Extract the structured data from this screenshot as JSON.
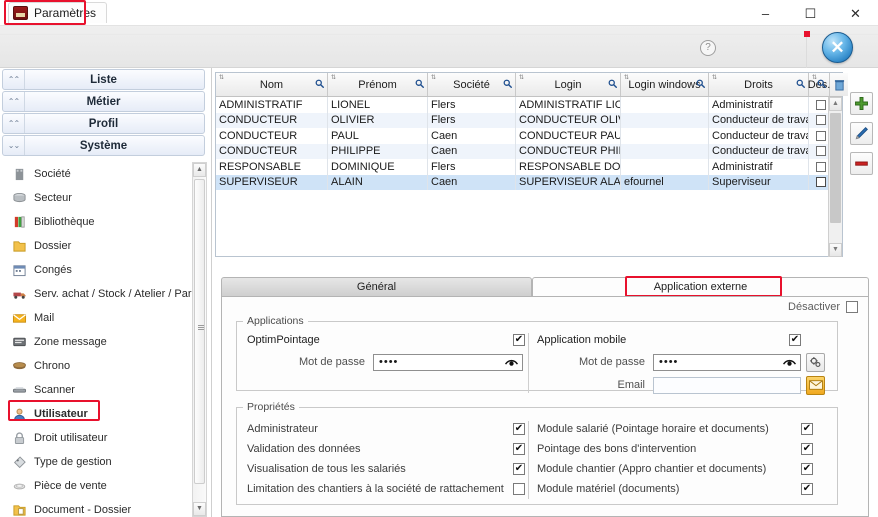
{
  "window": {
    "tab_label": "Paramètres",
    "app_icon": "etp-logo-icon",
    "minimize": "–",
    "maximize": "☐",
    "close": "✕"
  },
  "ribbon": {
    "help_icon": "?",
    "close_round_icon": "✕"
  },
  "sidebar": {
    "accordions": [
      {
        "label": "Liste",
        "icon": "chevron-up-icon",
        "chev": "«",
        "expanded": false
      },
      {
        "label": "Métier",
        "icon": "chevron-up-icon",
        "chev": "«",
        "expanded": false
      },
      {
        "label": "Profil",
        "icon": "chevron-up-icon",
        "chev": "«",
        "expanded": false
      },
      {
        "label": "Système",
        "icon": "chevron-down-icon",
        "chev": "»",
        "expanded": true
      }
    ],
    "items": [
      {
        "label": "Société",
        "icon": "building-icon",
        "active": false
      },
      {
        "label": "Secteur",
        "icon": "cylinder-icon",
        "active": false
      },
      {
        "label": "Bibliothèque",
        "icon": "books-icon",
        "active": false
      },
      {
        "label": "Dossier",
        "icon": "folder-icon",
        "active": false
      },
      {
        "label": "Congés",
        "icon": "calendar-icon",
        "active": false
      },
      {
        "label": "Serv. achat / Stock / Atelier / Parc",
        "icon": "truck-icon",
        "active": false
      },
      {
        "label": "Mail",
        "icon": "envelope-icon",
        "active": false
      },
      {
        "label": "Zone message",
        "icon": "message-icon",
        "active": false
      },
      {
        "label": "Chrono",
        "icon": "chrono-icon",
        "active": false
      },
      {
        "label": "Scanner",
        "icon": "scanner-icon",
        "active": false
      },
      {
        "label": "Utilisateur",
        "icon": "user-icon",
        "active": true
      },
      {
        "label": "Droit utilisateur",
        "icon": "lock-icon",
        "active": false
      },
      {
        "label": "Type de gestion",
        "icon": "tag-icon",
        "active": false
      },
      {
        "label": "Pièce de vente",
        "icon": "coin-icon",
        "active": false
      },
      {
        "label": "Document - Dossier",
        "icon": "folder-doc-icon",
        "active": false
      }
    ]
  },
  "grid": {
    "columns": [
      {
        "label": "Nom",
        "width": 112
      },
      {
        "label": "Prénom",
        "width": 100
      },
      {
        "label": "Société",
        "width": 88
      },
      {
        "label": "Login",
        "width": 105
      },
      {
        "label": "Login windows",
        "width": 88
      },
      {
        "label": "Droits",
        "width": 100
      },
      {
        "label": "Des.",
        "width": 21
      }
    ],
    "search_icon": "magnifier-icon",
    "delete_column_icon": "trash-icon",
    "rows": [
      {
        "nom": "ADMINISTRATIF",
        "prenom": "LIONEL",
        "societe": "Flers",
        "login": "ADMINISTRATIF LIONEL",
        "login_windows": "",
        "droits": "Administratif",
        "des": false,
        "selected": false
      },
      {
        "nom": "CONDUCTEUR",
        "prenom": "OLIVIER",
        "societe": "Flers",
        "login": "CONDUCTEUR OLIVIER",
        "login_windows": "",
        "droits": "Conducteur de travaux",
        "des": false,
        "selected": false
      },
      {
        "nom": "CONDUCTEUR",
        "prenom": "PAUL",
        "societe": "Caen",
        "login": "CONDUCTEUR PAUL",
        "login_windows": "",
        "droits": "Conducteur de travaux",
        "des": false,
        "selected": false
      },
      {
        "nom": "CONDUCTEUR",
        "prenom": "PHILIPPE",
        "societe": "Caen",
        "login": "CONDUCTEUR PHILIPPE",
        "login_windows": "",
        "droits": "Conducteur de travaux",
        "des": false,
        "selected": false
      },
      {
        "nom": "RESPONSABLE",
        "prenom": "DOMINIQUE",
        "societe": "Flers",
        "login": "RESPONSABLE DOMIN...",
        "login_windows": "",
        "droits": "Administratif",
        "des": false,
        "selected": false
      },
      {
        "nom": "SUPERVISEUR",
        "prenom": "ALAIN",
        "societe": "Caen",
        "login": "SUPERVISEUR ALAIN",
        "login_windows": "efournel",
        "droits": "Superviseur",
        "des": false,
        "selected": true
      }
    ]
  },
  "actions": [
    {
      "name": "add-button",
      "icon": "plus-icon",
      "color": "#4e9a2f"
    },
    {
      "name": "edit-button",
      "icon": "pencil-icon",
      "color": "#2a6fb5"
    },
    {
      "name": "delete-button",
      "icon": "minus-icon",
      "color": "#cc2222"
    }
  ],
  "tabs": [
    {
      "label": "Général",
      "active": false
    },
    {
      "label": "Application externe",
      "active": true
    }
  ],
  "panel": {
    "desactiver": {
      "label": "Désactiver",
      "checked": false
    },
    "applications": {
      "legend": "Applications",
      "optim": {
        "name": "OptimPointage",
        "enabled": true,
        "password_label": "Mot de passe",
        "password_value": "••••",
        "reveal_icon": "eye-icon"
      },
      "mobile": {
        "name": "Application mobile",
        "enabled": true,
        "password_label": "Mot de passe",
        "password_value": "••••",
        "reveal_icon": "eye-icon",
        "email_label": "Email",
        "email_value": "",
        "settings_icon": "gear-icon",
        "mail_icon": "envelope-icon"
      }
    },
    "proprietes": {
      "legend": "Propriétés",
      "left": [
        {
          "label": "Administrateur",
          "checked": true
        },
        {
          "label": "Validation des données",
          "checked": true
        },
        {
          "label": "Visualisation de tous les salariés",
          "checked": true
        },
        {
          "label": "Limitation des chantiers à la société de rattachement",
          "checked": false
        }
      ],
      "right": [
        {
          "label": "Module salarié (Pointage horaire et documents)",
          "checked": true
        },
        {
          "label": "Pointage des bons d'intervention",
          "checked": true
        },
        {
          "label": "Module chantier (Appro chantier et documents)",
          "checked": true
        },
        {
          "label": "Module matériel (documents)",
          "checked": true
        }
      ]
    }
  },
  "colors": {
    "highlight_red": "#e8112d",
    "selection_blue": "#cfe3f7",
    "accent_blue": "#2b84c6"
  }
}
